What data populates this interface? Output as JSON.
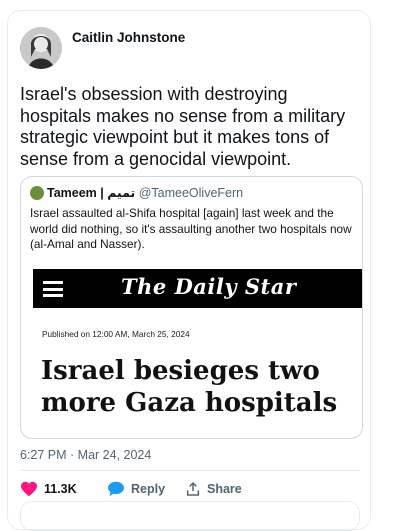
{
  "tweet": {
    "author_name": "Caitlin Johnstone",
    "text": "Israel's obsession with destroying hospitals makes no sense from a military strategic viewpoint but it makes tons of sense from a genocidal viewpoint.",
    "timestamp": "6:27 PM · Mar 24, 2024"
  },
  "quote": {
    "author_name": "Tameem | تميم",
    "handle": "@TameeOliveFern",
    "text": "Israel assaulted al-Shifa hospital [again] last week and the world did nothing, so it's assaulting another two hospitals now (al-Amal and Nasser).",
    "masthead": "The Daily Star",
    "published": "Published on 12:00 AM, March 25, 2024",
    "headline": "Israel besieges two more Gaza hospitals"
  },
  "actions": {
    "like_count": "11.3K",
    "reply_label": "Reply",
    "share_label": "Share"
  },
  "colors": {
    "like_heart": "#f91880",
    "reply_icon": "#1d9bf0",
    "muted_text": "#536471",
    "border": "#e6ecf0",
    "masthead_bg": "#000000"
  },
  "icons": {
    "like": "heart-icon",
    "reply": "speech-bubble-icon",
    "share": "share-upload-icon",
    "menu": "hamburger-menu-icon"
  }
}
